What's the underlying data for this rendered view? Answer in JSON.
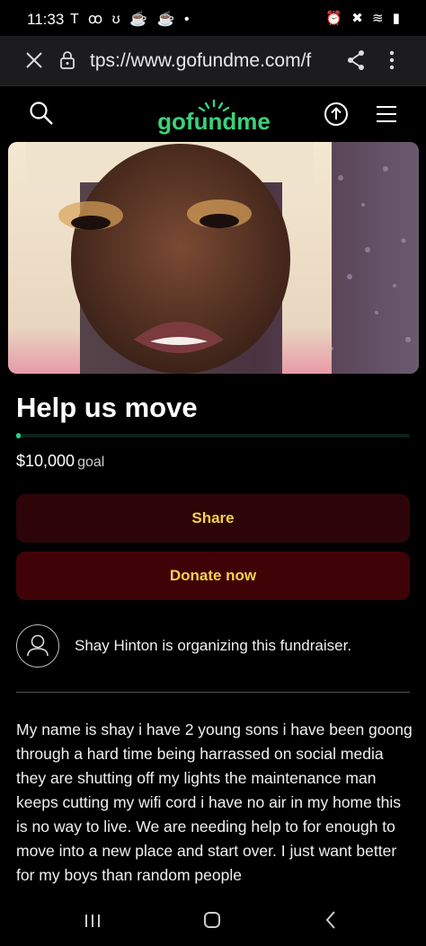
{
  "status_bar": {
    "time": "11:33",
    "left_icons": "T ꝏ ʊ ☕ ☕ •",
    "right_icons": "⏰ ✖ ≋ ▮"
  },
  "browser": {
    "url": "tps://www.gofundme.com/f",
    "icons": [
      "close-icon",
      "lock-icon",
      "share-icon",
      "more-icon"
    ]
  },
  "site_nav": {
    "logo": "gofundme",
    "icons": [
      "search-icon",
      "upload-icon",
      "menu-icon"
    ],
    "brand_color": "#3ad27b"
  },
  "campaign": {
    "title": "Help us move",
    "progress_fraction": 0.01,
    "goal_amount": "$10,000",
    "goal_word": "goal",
    "share_label": "Share",
    "donate_label": "Donate now",
    "organizer_text": "Shay Hinton is organizing this fundraiser.",
    "story": "My name is shay i have 2 young sons i have been goong through a hard time being harrassed on social media they are shutting off my lights the maintenance man keeps cutting my wifi cord i have no air in my home this is no way to live. We are needing help to for enough to move into a new place and start over. I just want better for my boys than random people"
  },
  "android_nav": {
    "icons": [
      "recent-apps-icon",
      "home-icon",
      "back-icon"
    ]
  }
}
